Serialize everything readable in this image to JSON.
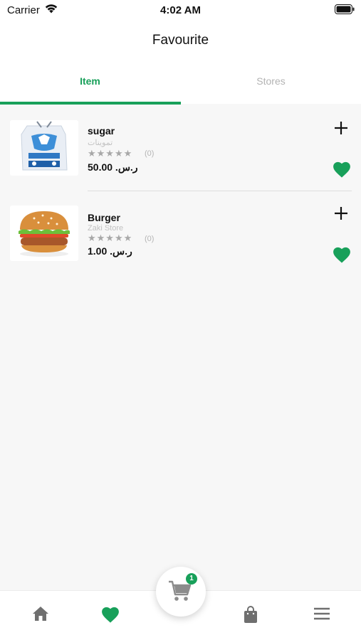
{
  "status_bar": {
    "carrier": "Carrier",
    "time": "4:02 AM"
  },
  "nav": {
    "title": "Favourite"
  },
  "tabs": [
    {
      "label": "Item",
      "active": true
    },
    {
      "label": "Stores",
      "active": false
    }
  ],
  "items": [
    {
      "name": "sugar",
      "store": "تموينات",
      "stars": "★★★★★",
      "rating_count": "(0)",
      "price": "50.00 .ر.س",
      "favorited": true,
      "image_icon": "sugar-bag-image"
    },
    {
      "name": "Burger",
      "store": "Zaki Store",
      "stars": "★★★★★",
      "rating_count": "(0)",
      "price": "1.00 .ر.س",
      "favorited": true,
      "image_icon": "burger-image"
    }
  ],
  "bottom_bar": {
    "items": [
      "home-icon",
      "heart-icon",
      "cart-icon",
      "bag-icon",
      "menu-icon"
    ],
    "cart_badge": "1"
  },
  "colors": {
    "accent": "#18a05a",
    "background": "#f7f7f7"
  }
}
